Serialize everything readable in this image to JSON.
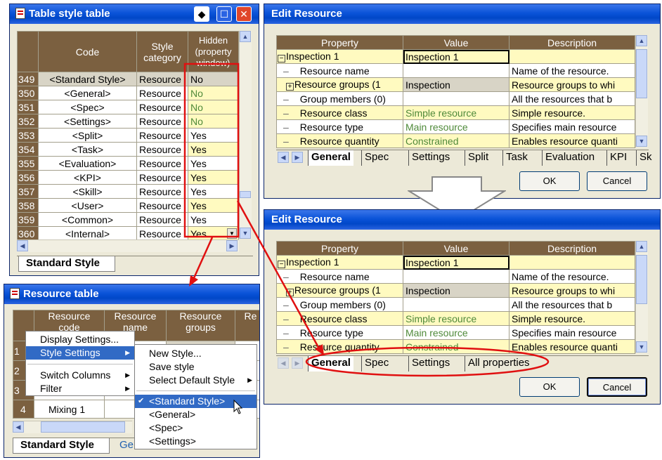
{
  "table_style": {
    "title": "Table style table",
    "headers": {
      "code": "Code",
      "category": "Style category",
      "hidden": "Hidden (property window)"
    },
    "rows": [
      {
        "num": "349",
        "code": "<Standard Style>",
        "category": "Resource",
        "hidden": "No"
      },
      {
        "num": "350",
        "code": "<General>",
        "category": "Resource",
        "hidden": "No"
      },
      {
        "num": "351",
        "code": "<Spec>",
        "category": "Resource",
        "hidden": "No"
      },
      {
        "num": "352",
        "code": "<Settings>",
        "category": "Resource",
        "hidden": "No"
      },
      {
        "num": "353",
        "code": "<Split>",
        "category": "Resource",
        "hidden": "Yes"
      },
      {
        "num": "354",
        "code": "<Task>",
        "category": "Resource",
        "hidden": "Yes"
      },
      {
        "num": "355",
        "code": "<Evaluation>",
        "category": "Resource",
        "hidden": "Yes"
      },
      {
        "num": "356",
        "code": "<KPI>",
        "category": "Resource",
        "hidden": "Yes"
      },
      {
        "num": "357",
        "code": "<Skill>",
        "category": "Resource",
        "hidden": "Yes"
      },
      {
        "num": "358",
        "code": "<User>",
        "category": "Resource",
        "hidden": "Yes"
      },
      {
        "num": "359",
        "code": "<Common>",
        "category": "Resource",
        "hidden": "Yes"
      },
      {
        "num": "360",
        "code": "<Internal>",
        "category": "Resource",
        "hidden": "Yes"
      }
    ],
    "tab": "Standard Style"
  },
  "resource_table": {
    "title": "Resource table",
    "headers": [
      "Resource code",
      "Resource name",
      "Resource groups",
      "Re"
    ],
    "row4": {
      "num": "4",
      "name": "Mixing 1"
    },
    "row_nums": [
      "1",
      "2",
      "3"
    ],
    "tabs": [
      "Standard Style",
      "Gen"
    ],
    "context_menu": [
      "Display Settings...",
      "Style Settings",
      "Switch Columns",
      "Filter"
    ],
    "submenu": [
      "New Style...",
      "Save style",
      "Select Default Style",
      "<Standard Style>",
      "<General>",
      "<Spec>",
      "<Settings>"
    ],
    "checkmark": "✔"
  },
  "edit_resource_top": {
    "title": "Edit Resource",
    "headers": [
      "Property",
      "Value",
      "Description"
    ],
    "rows": [
      {
        "prop": "Inspection 1",
        "value": "Inspection 1",
        "desc": ""
      },
      {
        "prop": "Resource name",
        "value": "",
        "desc": "Name of the resource."
      },
      {
        "prop": "Resource groups (1",
        "value": "Inspection",
        "desc": "Resource groups to whi"
      },
      {
        "prop": "Group members (0)",
        "value": "",
        "desc": "All the resources that b"
      },
      {
        "prop": "Resource class",
        "value": "Simple resource",
        "desc": "Simple resource."
      },
      {
        "prop": "Resource type",
        "value": "Main resource",
        "desc": "Specifies main resource"
      },
      {
        "prop": "Resource quantity",
        "value": "Constrained",
        "desc": "Enables resource quanti"
      }
    ],
    "tabs": [
      "General",
      "Spec",
      "Settings",
      "Split",
      "Task",
      "Evaluation",
      "KPI",
      "Sk"
    ],
    "ok": "OK",
    "cancel": "Cancel"
  },
  "edit_resource_bottom": {
    "title": "Edit Resource",
    "tabs": [
      "General",
      "Spec",
      "Settings",
      "All properties"
    ],
    "ok": "OK",
    "cancel": "Cancel"
  },
  "colors": {
    "annotation": "#e01010",
    "header": "#7b6040",
    "cell_yellow": "#fffac0",
    "value_green": "#4f8a3a"
  }
}
